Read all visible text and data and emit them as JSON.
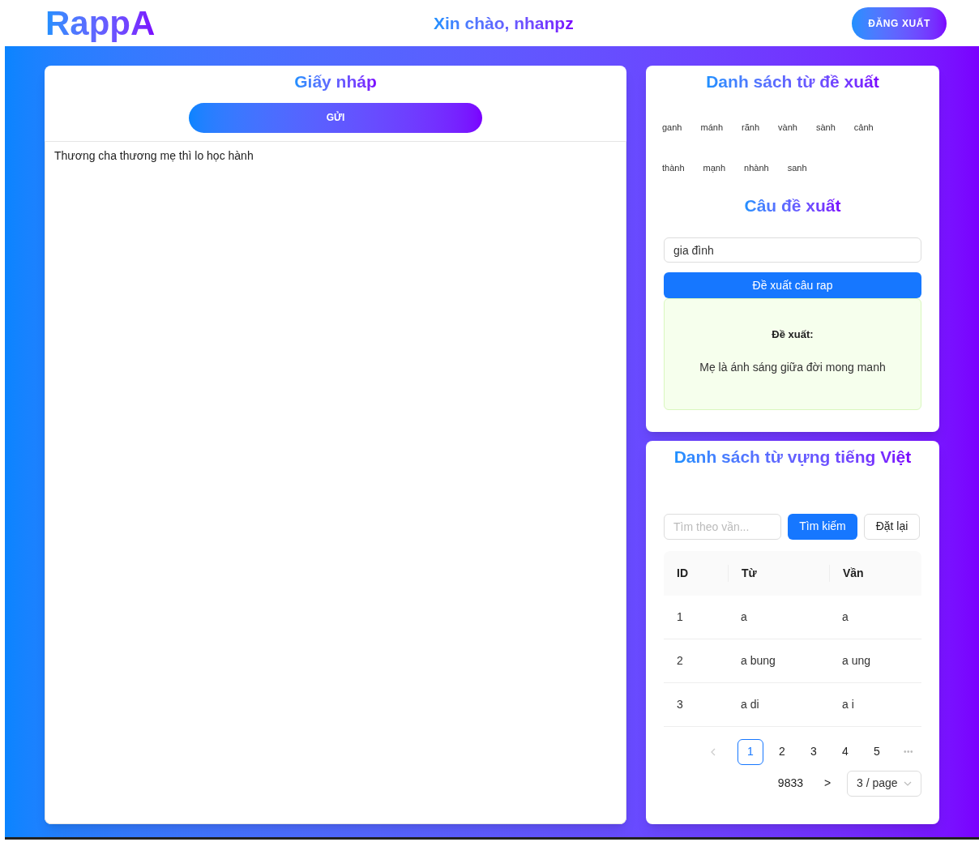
{
  "header": {
    "logo": "RappA",
    "greeting": "Xin chào, nhanpz",
    "logout": "ĐĂNG XUẤT"
  },
  "draft": {
    "title": "Giấy nháp",
    "send": "GỬI",
    "text": "Thương cha thương mẹ thì lo học hành"
  },
  "suggestions": {
    "title": "Danh sách từ đề xuất",
    "words": [
      "ganh",
      "mánh",
      "rãnh",
      "vành",
      "sành",
      "cảnh",
      "thành",
      "mạnh",
      "nhành",
      "sanh"
    ],
    "sentence_title": "Câu đề xuất",
    "topic": "gia đình",
    "suggest_button": "Đề xuất câu rap",
    "result_label": "Đề xuất:",
    "result": "Mẹ là ánh sáng giữa đời mong manh"
  },
  "vocabulary": {
    "title": "Danh sách từ vựng tiếng Việt",
    "search_placeholder": "Tìm theo vần...",
    "search_button": "Tìm kiếm",
    "reset_button": "Đặt lại",
    "columns": [
      "ID",
      "Từ",
      "Vần"
    ],
    "rows": [
      [
        "1",
        "a",
        "a"
      ],
      [
        "2",
        "a bung",
        "a ung"
      ],
      [
        "3",
        "a di",
        "a i"
      ]
    ],
    "pages": [
      {
        "label": "1",
        "selected": true
      },
      {
        "label": "2",
        "selected": false
      },
      {
        "label": "3",
        "selected": false
      },
      {
        "label": "4",
        "selected": false
      },
      {
        "label": "5",
        "selected": false
      }
    ],
    "ellipsis": "•••",
    "last_page": "9833",
    "next": ">",
    "page_size": "3 / page"
  }
}
